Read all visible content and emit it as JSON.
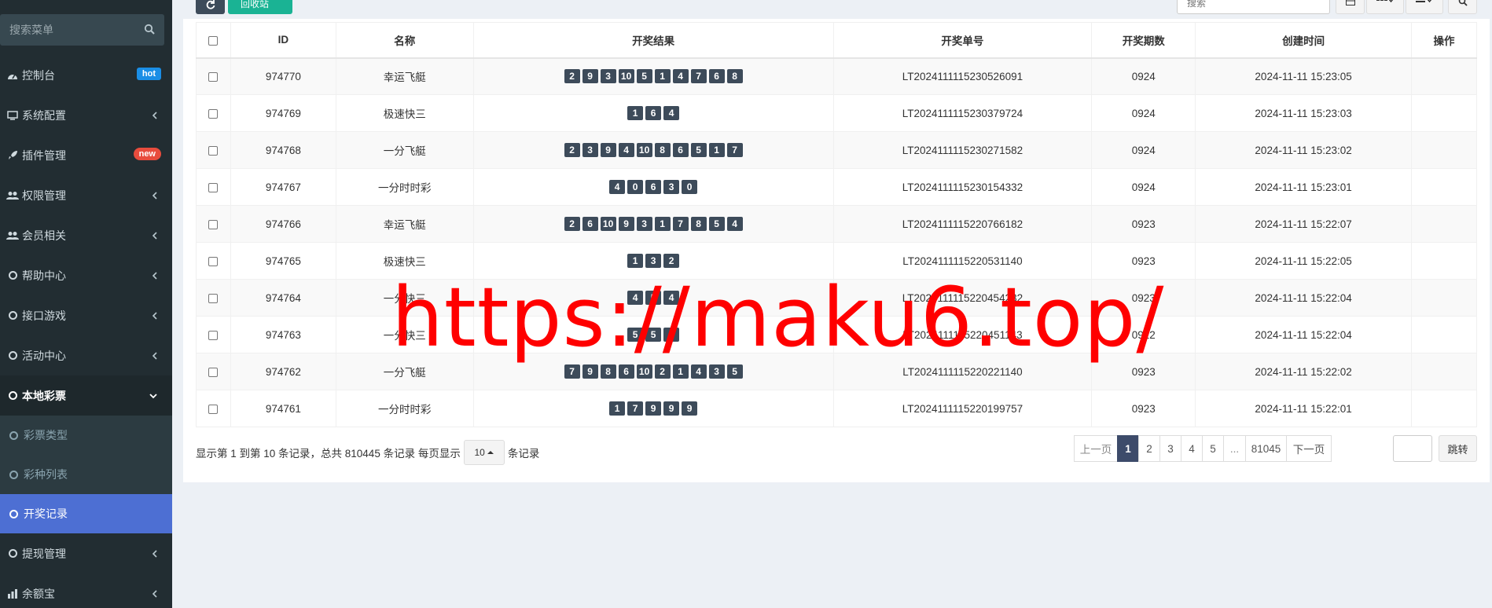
{
  "sidebar": {
    "search_placeholder": "搜索菜单",
    "items": [
      {
        "label": "控制台",
        "badge": "hot"
      },
      {
        "label": "系统配置"
      },
      {
        "label": "插件管理",
        "badge": "new"
      },
      {
        "label": "权限管理"
      },
      {
        "label": "会员相关"
      },
      {
        "label": "帮助中心"
      },
      {
        "label": "接口游戏"
      },
      {
        "label": "活动中心"
      },
      {
        "label": "本地彩票"
      },
      {
        "label": "提现管理"
      },
      {
        "label": "余额宝"
      }
    ],
    "subitems": [
      {
        "label": "彩票类型"
      },
      {
        "label": "彩种列表"
      },
      {
        "label": "开奖记录"
      }
    ]
  },
  "toolbar": {
    "recycle_label": "回收站",
    "search_placeholder": "搜索"
  },
  "table": {
    "columns": [
      "ID",
      "名称",
      "开奖结果",
      "开奖单号",
      "开奖期数",
      "创建时间",
      "操作"
    ],
    "rows": [
      {
        "id": "974770",
        "name": "幸运飞艇",
        "balls": [
          "2",
          "9",
          "3",
          "10",
          "5",
          "1",
          "4",
          "7",
          "6",
          "8"
        ],
        "order": "LT2024111115230526091",
        "period": "0924",
        "created": "2024-11-11 15:23:05"
      },
      {
        "id": "974769",
        "name": "极速快三",
        "balls": [
          "1",
          "6",
          "4"
        ],
        "order": "LT2024111115230379724",
        "period": "0924",
        "created": "2024-11-11 15:23:03"
      },
      {
        "id": "974768",
        "name": "一分飞艇",
        "balls": [
          "2",
          "3",
          "9",
          "4",
          "10",
          "8",
          "6",
          "5",
          "1",
          "7"
        ],
        "order": "LT2024111115230271582",
        "period": "0924",
        "created": "2024-11-11 15:23:02"
      },
      {
        "id": "974767",
        "name": "一分时时彩",
        "balls": [
          "4",
          "0",
          "6",
          "3",
          "0"
        ],
        "order": "LT2024111115230154332",
        "period": "0924",
        "created": "2024-11-11 15:23:01"
      },
      {
        "id": "974766",
        "name": "幸运飞艇",
        "balls": [
          "2",
          "6",
          "10",
          "9",
          "3",
          "1",
          "7",
          "8",
          "5",
          "4"
        ],
        "order": "LT2024111115220766182",
        "period": "0923",
        "created": "2024-11-11 15:22:07"
      },
      {
        "id": "974765",
        "name": "极速快三",
        "balls": [
          "1",
          "3",
          "2"
        ],
        "order": "LT2024111115220531140",
        "period": "0923",
        "created": "2024-11-11 15:22:05"
      },
      {
        "id": "974764",
        "name": "一分快三",
        "balls": [
          "4",
          "5",
          "4"
        ],
        "order": "LT2024111115220454232",
        "period": "0923",
        "created": "2024-11-11 15:22:04"
      },
      {
        "id": "974763",
        "name": "一分快三",
        "balls": [
          "5",
          "5",
          "1"
        ],
        "order": "LT2024111115220451143",
        "period": "0922",
        "created": "2024-11-11 15:22:04"
      },
      {
        "id": "974762",
        "name": "一分飞艇",
        "balls": [
          "7",
          "9",
          "8",
          "6",
          "10",
          "2",
          "1",
          "4",
          "3",
          "5"
        ],
        "order": "LT2024111115220221140",
        "period": "0923",
        "created": "2024-11-11 15:22:02"
      },
      {
        "id": "974761",
        "name": "一分时时彩",
        "balls": [
          "1",
          "7",
          "9",
          "9",
          "9"
        ],
        "order": "LT2024111115220199757",
        "period": "0923",
        "created": "2024-11-11 15:22:01"
      }
    ]
  },
  "pagination": {
    "info_prefix": "显示第 1 到第 10 条记录，总共 810445 条记录 每页显示",
    "page_size": "10",
    "info_suffix": "条记录",
    "pages": [
      {
        "label": "上一页",
        "state": "disabled"
      },
      {
        "label": "1",
        "state": "active"
      },
      {
        "label": "2"
      },
      {
        "label": "3"
      },
      {
        "label": "4"
      },
      {
        "label": "5"
      },
      {
        "label": "...",
        "state": "disabled"
      },
      {
        "label": "81045"
      },
      {
        "label": "下一页"
      }
    ],
    "jump_label": "跳转"
  },
  "watermark": "https://maku6.top/",
  "colors": {
    "sidebar_bg": "#222d32",
    "active_menu": "#4d6fd3",
    "ball_bg": "#3d4b5a",
    "recycle_green": "#1ab394",
    "watermark_red": "#ff0000"
  }
}
